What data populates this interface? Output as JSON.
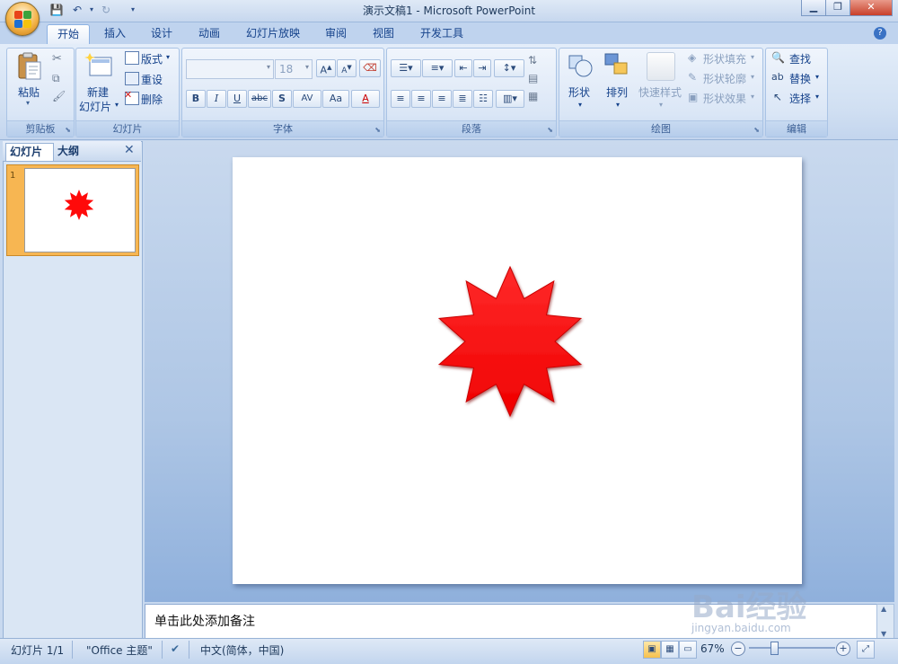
{
  "window": {
    "title": "演示文稿1 - Microsoft PowerPoint"
  },
  "tabs": [
    "开始",
    "插入",
    "设计",
    "动画",
    "幻灯片放映",
    "审阅",
    "视图",
    "开发工具"
  ],
  "groups": {
    "clipboard": {
      "label": "剪贴板",
      "paste": "粘贴"
    },
    "slides": {
      "label": "幻灯片",
      "new_slide_1": "新建",
      "new_slide_2": "幻灯片",
      "layout": "版式",
      "reset": "重设",
      "delete": "删除"
    },
    "font": {
      "label": "字体",
      "font_size": "18",
      "bold": "B",
      "italic": "I",
      "underline": "U",
      "strike": "abc",
      "shadow": "S",
      "spacing": "AV",
      "case": "Aa",
      "color": "A"
    },
    "paragraph": {
      "label": "段落"
    },
    "drawing": {
      "label": "绘图",
      "shapes": "形状",
      "arrange": "排列",
      "quick_styles": "快速样式",
      "fill": "形状填充",
      "outline": "形状轮廓",
      "effects": "形状效果"
    },
    "editing": {
      "label": "编辑",
      "find": "查找",
      "replace": "替换",
      "select": "选择"
    }
  },
  "panel": {
    "tab_slides": "幻灯片",
    "tab_outline": "大纲",
    "slide_number": "1"
  },
  "notes": {
    "placeholder": "单击此处添加备注"
  },
  "status": {
    "slide": "幻灯片 1/1",
    "theme": "\"Office 主题\"",
    "language": "中文(简体，中国)",
    "zoom": "67%"
  },
  "watermark": {
    "main": "Bai经验",
    "sub": "jingyan.baidu.com"
  },
  "colors": {
    "star": "#ff0a0a",
    "ribbon": "#dae6f6"
  }
}
